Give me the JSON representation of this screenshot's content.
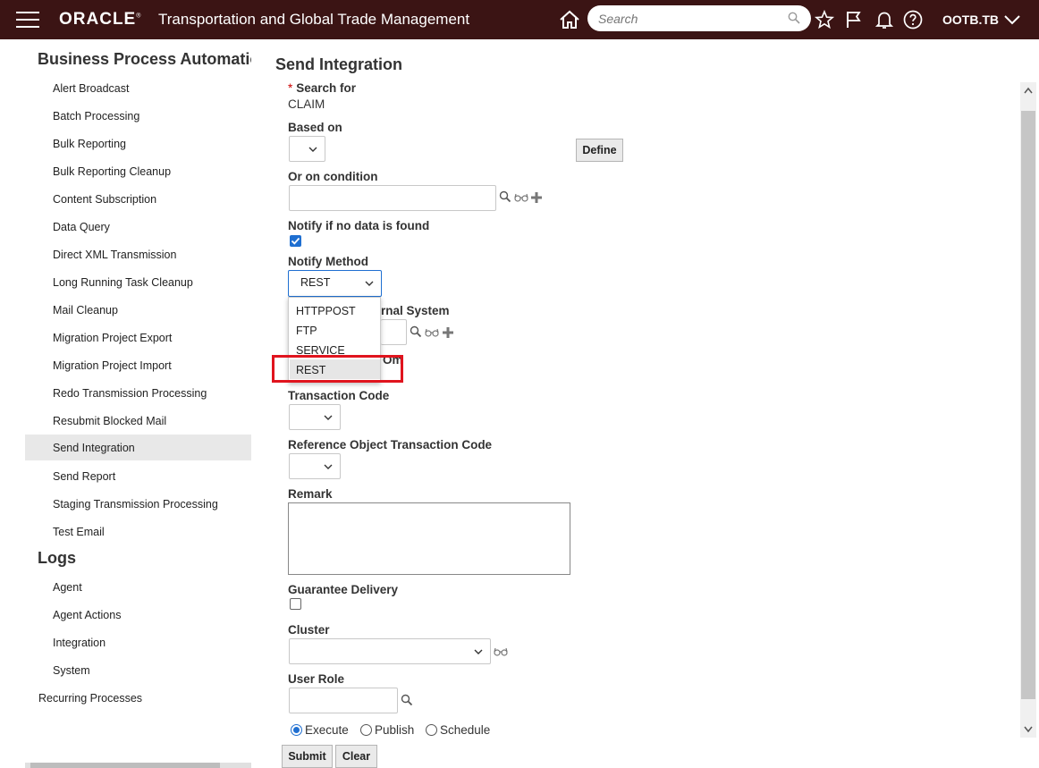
{
  "header": {
    "logo": "ORACLE",
    "app_title": "Transportation and Global Trade Management",
    "search_placeholder": "Search",
    "user": "OOTB.TB"
  },
  "sidebar": {
    "section_title": "Business Process Automation",
    "items": [
      "Alert Broadcast",
      "Batch Processing",
      "Bulk Reporting",
      "Bulk Reporting Cleanup",
      "Content Subscription",
      "Data Query",
      "Direct XML Transmission",
      "Long Running Task Cleanup",
      "Mail Cleanup",
      "Migration Project Export",
      "Migration Project Import",
      "Redo Transmission Processing",
      "Resubmit Blocked Mail",
      "Send Integration",
      "Send Report",
      "Staging Transmission Processing",
      "Test Email"
    ],
    "active_item": "Send Integration",
    "logs_title": "Logs",
    "logs_items": [
      "Agent",
      "Agent Actions",
      "Integration",
      "System"
    ],
    "recurring": "Recurring Processes"
  },
  "main": {
    "title": "Send Integration",
    "search_for_label": "Search for",
    "search_for_value": "CLAIM",
    "based_on_label": "Based on",
    "define_button": "Define",
    "or_on_condition_label": "Or on condition",
    "notify_no_data_label": "Notify if no data is found",
    "notify_no_data_checked": true,
    "notify_method_label": "Notify Method",
    "notify_method_value": "REST",
    "external_system_label_visible": "rnal System",
    "hidden_label_fragment": "Om",
    "transaction_code_label": "Transaction Code",
    "ref_obj_tx_code_label": "Reference Object Transaction Code",
    "remark_label": "Remark",
    "guarantee_delivery_label": "Guarantee Delivery",
    "guarantee_delivery_checked": false,
    "cluster_label": "Cluster",
    "user_role_label": "User Role",
    "radios": [
      "Execute",
      "Publish",
      "Schedule"
    ],
    "radio_selected": "Execute",
    "submit_button": "Submit",
    "clear_button": "Clear"
  },
  "notify_method_dropdown": {
    "options": [
      "HTTPPOST",
      "FTP",
      "SERVICE",
      "REST"
    ],
    "highlighted": "REST"
  },
  "colors": {
    "header_bg": "#3b1414",
    "accent": "#1f6fd1",
    "highlight_box": "#e0141e"
  }
}
